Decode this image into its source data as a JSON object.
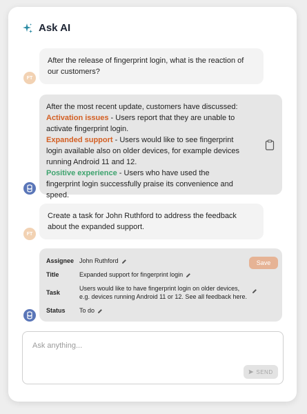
{
  "header": {
    "title": "Ask AI",
    "icon": "sparkle-icon"
  },
  "messages": [
    {
      "role": "user",
      "avatar": "FT",
      "text": "After the release of fingerprint login, what is the reaction of our customers?"
    },
    {
      "role": "ai",
      "intro": "After the most recent update, customers have discussed:",
      "items": [
        {
          "label": "Activation issues",
          "color": "#d35f23",
          "text": " - Users report that they are unable to activate fingerprint login."
        },
        {
          "label": "Expanded support",
          "color": "#d35f23",
          "text": " - Users would like to see fingerprint login available also on older devices, for example devices running Android 11 and 12."
        },
        {
          "label": "Positive experience",
          "color": "#3ea36e",
          "text": " - Users who have used the fingerprint login successfully praise its convenience and speed."
        }
      ]
    },
    {
      "role": "user",
      "avatar": "FT",
      "text": "Create a task for John Ruthford to address the feedback about the expanded support."
    }
  ],
  "task": {
    "save_label": "Save",
    "fields": [
      {
        "label": "Assignee",
        "value": "John Ruthford"
      },
      {
        "label": "Title",
        "value": "Expanded support for fingerprint login"
      },
      {
        "label": "Task",
        "value_line1": "Users would like to have fingerprint login on older devices,",
        "value_line2": "e.g. devices running Android 11 or 12. See all feedback here."
      },
      {
        "label": "Status",
        "value": "To do"
      }
    ]
  },
  "composer": {
    "placeholder": "Ask anything...",
    "send_label": "SEND"
  },
  "colors": {
    "accent": "#d35f23",
    "positive": "#3ea36e",
    "ai_avatar": "#5a76b8"
  }
}
